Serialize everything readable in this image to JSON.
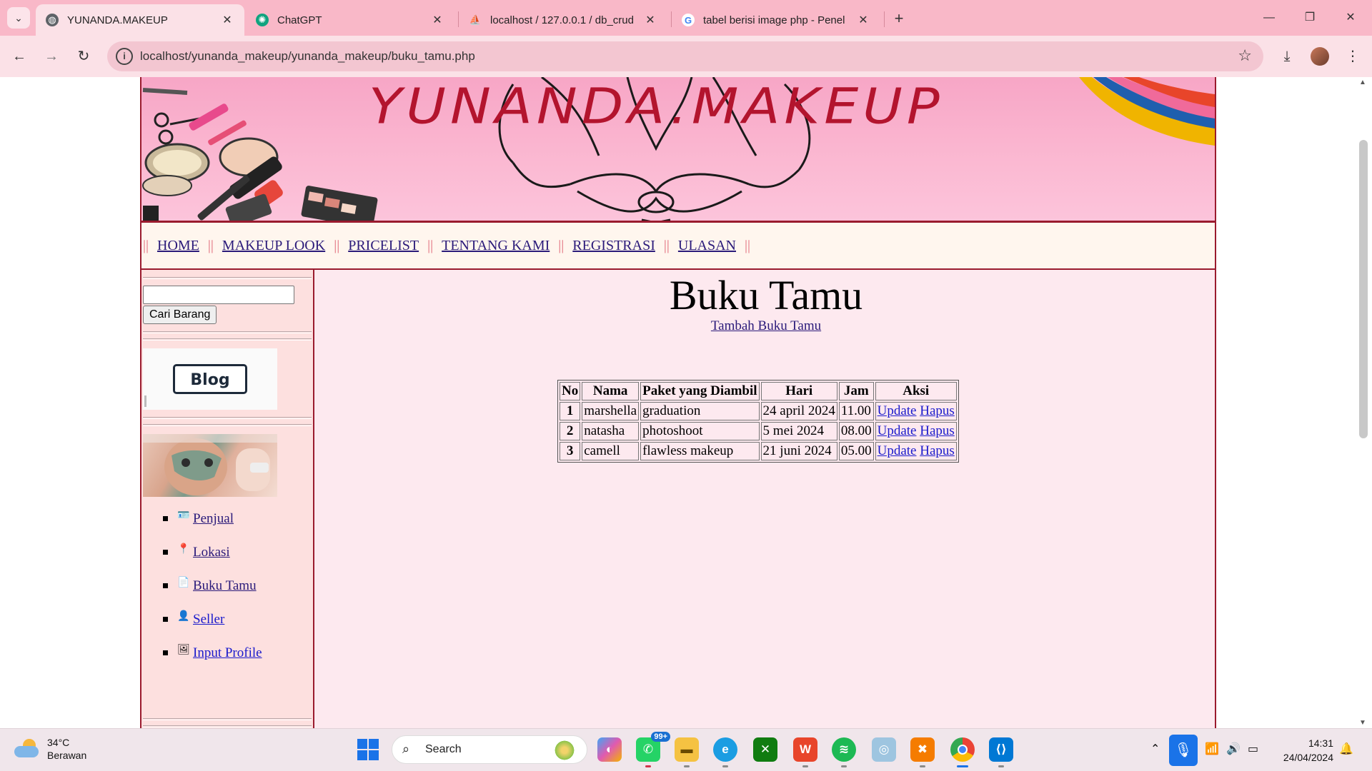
{
  "browser": {
    "tabs": [
      {
        "label": "YUNANDA.MAKEUP",
        "favicon": "globe-icon",
        "active": true
      },
      {
        "label": "ChatGPT",
        "favicon": "chatgpt-icon",
        "active": false
      },
      {
        "label": "localhost / 127.0.0.1 / db_crud",
        "favicon": "phpmyadmin-icon",
        "active": false
      },
      {
        "label": "tabel berisi image php - Penel",
        "favicon": "google-icon",
        "active": false
      }
    ],
    "url": "localhost/yunanda_makeup/yunanda_makeup/buku_tamu.php"
  },
  "site": {
    "banner_title": "YUNANDA.MAKEUP",
    "menu": [
      "HOME",
      "MAKEUP LOOK",
      "PRICELIST",
      "TENTANG KAMI",
      "REGISTRASI",
      "ULASAN"
    ],
    "menu_separator": "||",
    "sidebar": {
      "search_button": "Cari Barang",
      "blog_label": "Blog",
      "links": [
        {
          "label": "Penjual",
          "icon": "seller-card-icon"
        },
        {
          "label": "Lokasi",
          "icon": "map-pin-icon"
        },
        {
          "label": "Buku Tamu",
          "icon": "guestbook-icon"
        },
        {
          "label": "Seller",
          "icon": "person-icon"
        },
        {
          "label": "Input Profile",
          "icon": "profile-image-icon"
        }
      ]
    },
    "main": {
      "title": "Buku Tamu",
      "add_link": "Tambah Buku Tamu",
      "table": {
        "headers": [
          "No",
          "Nama",
          "Paket yang Diambil",
          "Hari",
          "Jam",
          "Aksi"
        ],
        "rows": [
          {
            "no": "1",
            "nama": "marshella",
            "paket": "graduation",
            "hari": "24 april 2024",
            "jam": "11.00",
            "update": "Update",
            "hapus": "Hapus"
          },
          {
            "no": "2",
            "nama": "natasha",
            "paket": "photoshoot",
            "hari": "5 mei 2024",
            "jam": "08.00",
            "update": "Update",
            "hapus": "Hapus"
          },
          {
            "no": "3",
            "nama": "camell",
            "paket": "flawless makeup",
            "hari": "21 juni 2024",
            "jam": "05.00",
            "update": "Update",
            "hapus": "Hapus"
          }
        ]
      }
    }
  },
  "taskbar": {
    "weather_temp": "34°C",
    "weather_desc": "Berawan",
    "search_placeholder": "Search",
    "whatsapp_badge": "99+",
    "time": "14:31",
    "date": "24/04/2024"
  },
  "colors": {
    "tabbar": "#f9b8c8",
    "toolbar": "#fbe1e7",
    "site_border": "#9a1b2e",
    "banner_title": "#b3142e",
    "link": "#2a1a7a"
  }
}
